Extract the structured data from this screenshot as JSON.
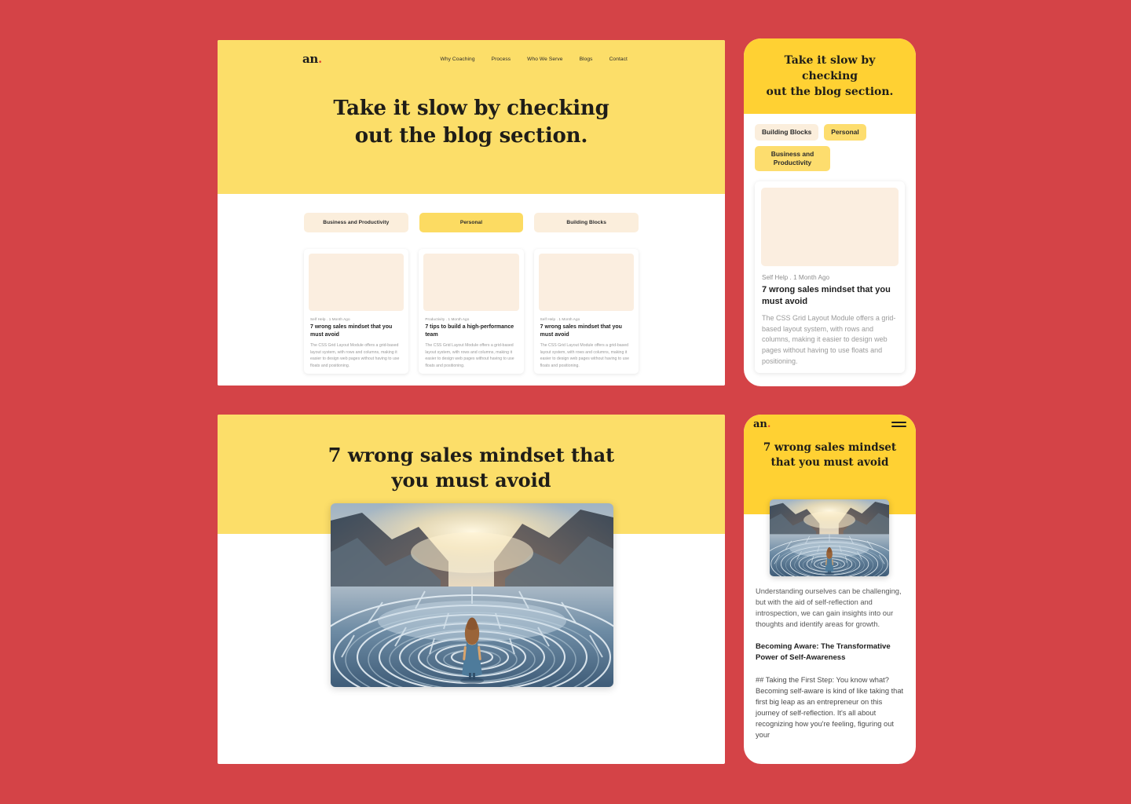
{
  "theme": {
    "page_background": "#d44347",
    "hero_yellow": "#fcde69",
    "mobile_hero_yellow": "#ffd133",
    "pill_inactive": "#fbeedc",
    "pill_active": "#fcdb62",
    "placeholder_cream": "#fbeee0",
    "logo_dot_red": "#e0452f",
    "text_dark": "#1f1d18",
    "text_muted": "#9a9a9a"
  },
  "desktop_blog_list": {
    "logo": {
      "text": "an",
      "dot": "."
    },
    "nav": [
      {
        "label": "Why Coaching"
      },
      {
        "label": "Process"
      },
      {
        "label": "Who We Serve"
      },
      {
        "label": "Blogs"
      },
      {
        "label": "Contact"
      }
    ],
    "hero_title_line1": "Take it slow by checking",
    "hero_title_line2": "out the blog section.",
    "filters": [
      {
        "label": "Business and Productivity",
        "active": false
      },
      {
        "label": "Personal",
        "active": true
      },
      {
        "label": "Building Blocks",
        "active": false
      }
    ],
    "cards": [
      {
        "category": "Self Help",
        "separator": ".",
        "date": "1 Month Ago",
        "title": "7 wrong sales mindset that you must avoid",
        "description": "The CSS Grid Layout Module offers a grid-based layout system, with rows and columns, making it easier to design web pages without having to use floats and positioning."
      },
      {
        "category": "Productivity",
        "separator": ".",
        "date": "1 Month Ago",
        "title": "7 tips to build a high-performance team",
        "description": "The CSS Grid Layout Module offers a grid-based layout system, with rows and columns, making it easier to design web pages without having to use floats and positioning."
      },
      {
        "category": "Self Help",
        "separator": ".",
        "date": "1 Month Ago",
        "title": "7 wrong sales mindset that you must avoid",
        "description": "The CSS Grid Layout Module offers a grid-based layout system, with rows and columns, making it easier to design web pages without having to use floats and positioning."
      }
    ]
  },
  "mobile_blog_list": {
    "hero_title_line1": "Take it slow by checking",
    "hero_title_line2": "out the blog section.",
    "filters": [
      {
        "label": "Building Blocks",
        "active": false
      },
      {
        "label": "Personal",
        "active": true
      },
      {
        "label": "Business and Productivity",
        "active": true
      }
    ],
    "card": {
      "category": "Self Help",
      "separator": ".",
      "date": "1 Month Ago",
      "title": "7 wrong sales mindset that you must avoid",
      "description": "The CSS Grid Layout Module offers a grid-based layout system, with rows and columns, making it easier to design web pages without having to use floats and positioning."
    }
  },
  "desktop_article": {
    "title_line1": "7 wrong sales mindset that",
    "title_line2": "you must avoid",
    "hero_image_alt": "woman-in-blue-dress-standing-in-circular-maze-at-sunset",
    "intro": "Understanding ourselves can be challenging, but with the aid of self-reflection and introspection, we can gain insights into our thoughts and identify areas for growth.",
    "heading": "Becoming Aware: The Transformative Power of Self-Awareness",
    "body": "## Taking the First Step: You know what? Becoming self-aware is kind of like taking that first big"
  },
  "mobile_article": {
    "logo": {
      "text": "an",
      "dot": "."
    },
    "menu_icon": "hamburger-menu-icon",
    "title_line1": "7 wrong sales mindset",
    "title_line2": "that you must avoid",
    "hero_image_alt": "woman-in-blue-dress-standing-in-circular-maze-at-sunset",
    "intro": "Understanding ourselves can be challenging, but with the aid of self-reflection and introspection, we can gain insights into our thoughts and identify areas for growth.",
    "heading": "Becoming Aware: The Transformative Power of Self-Awareness",
    "body": "## Taking the First Step: You know what? Becoming self-aware is kind of like taking that first big leap as an entrepreneur on this journey of self-reflection. It's all about recognizing how you're feeling, figuring out your"
  }
}
